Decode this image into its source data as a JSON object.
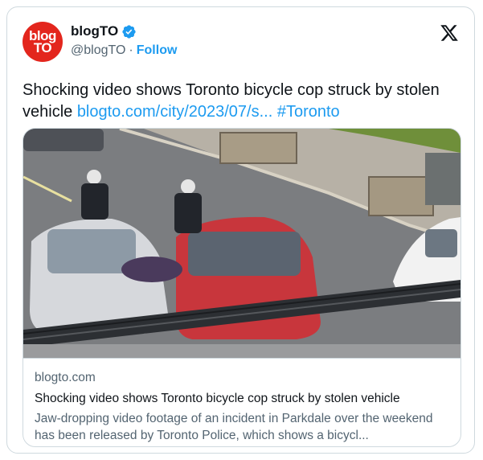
{
  "author": {
    "avatar_text_line1": "blog",
    "avatar_text_line2": "TO",
    "display_name": "blogTO",
    "handle": "@blogTO",
    "separator": "·",
    "follow_label": "Follow",
    "verified_icon": "verified-badge-icon"
  },
  "header": {
    "platform_icon": "x-logo-icon"
  },
  "tweet": {
    "text_main": "Shocking video shows Toronto bicycle cop struck by stolen vehicle ",
    "link_text": "blogto.com/city/2023/07/s...",
    "hashtag": "#Toronto"
  },
  "link_card": {
    "domain": "blogto.com",
    "title": "Shocking video shows Toronto bicycle cop struck by stolen vehicle",
    "description": "Jaw-dropping video footage of an incident in Parkdale over the weekend has been released by Toronto Police, which shows a bicycl..."
  },
  "colors": {
    "accent": "#1d9bf0",
    "brand_red": "#e3261d",
    "text": "#0f1419",
    "muted": "#536471",
    "border": "#cfd9de"
  }
}
